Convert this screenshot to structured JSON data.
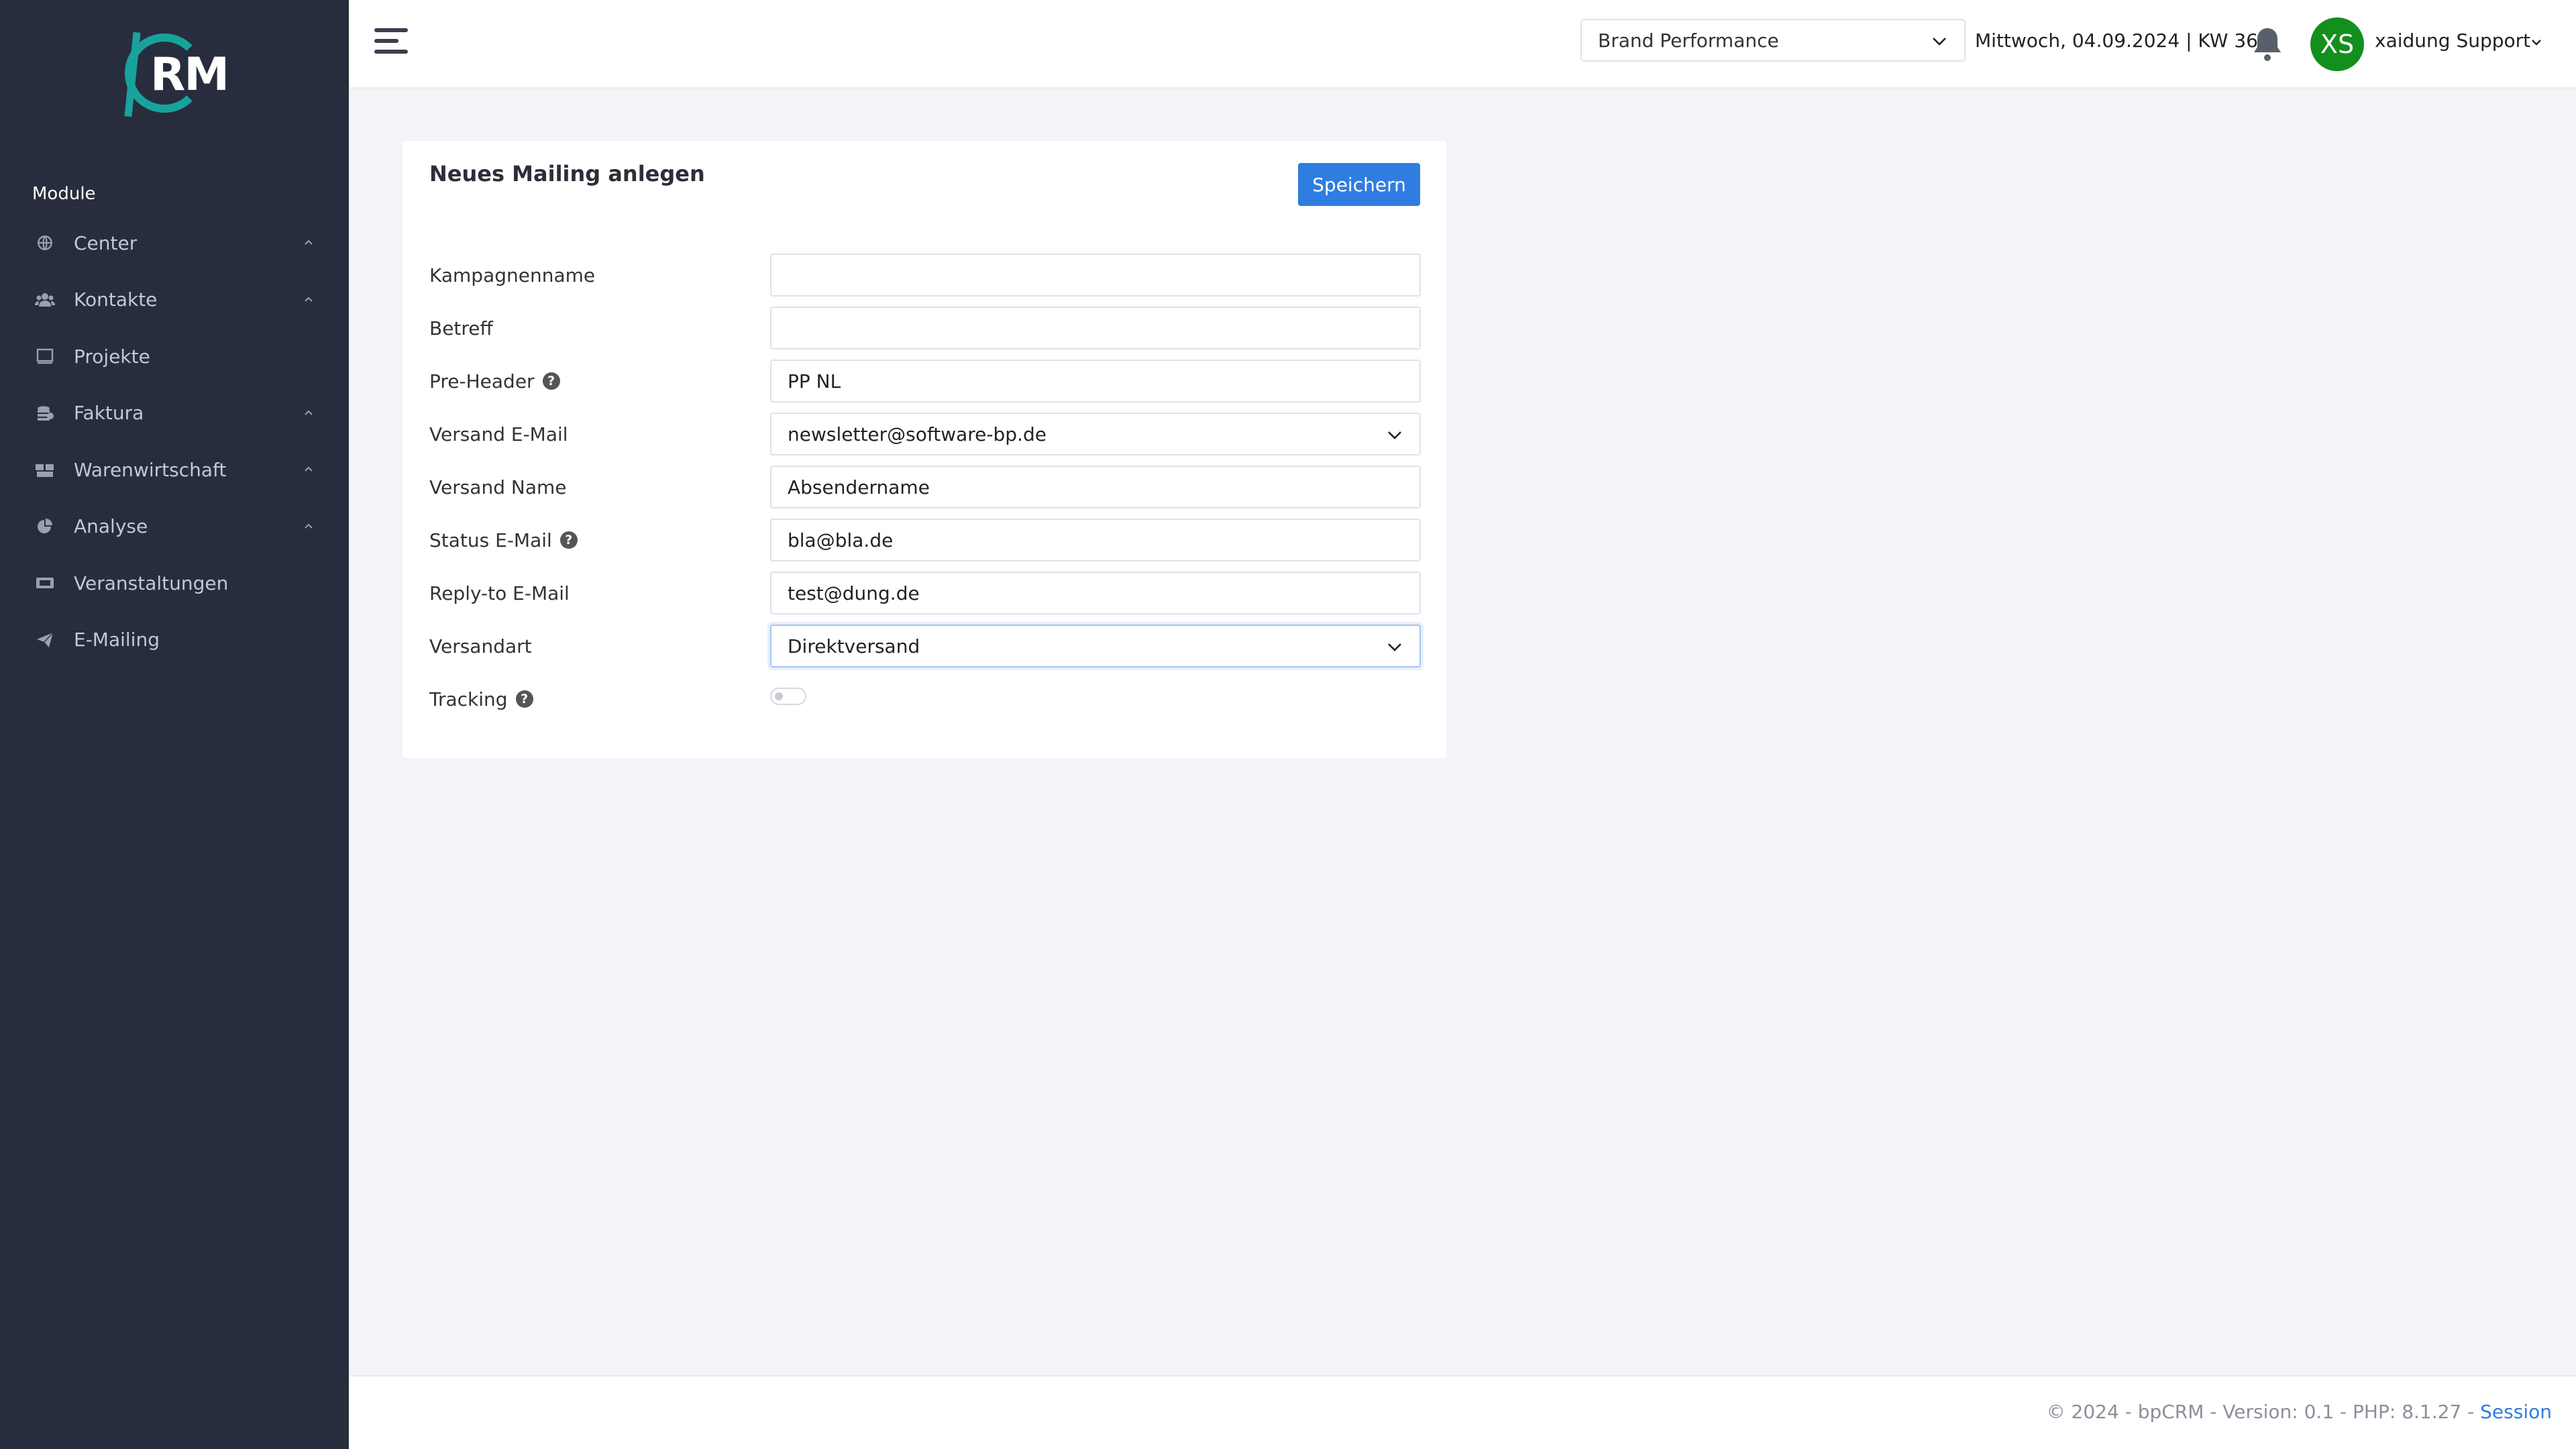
{
  "app": {
    "logo_text": "RM",
    "brand_color": "#17a39b"
  },
  "sidebar": {
    "section_label": "Module",
    "items": [
      {
        "label": "Center",
        "icon": "globe-icon",
        "has_chevron": true
      },
      {
        "label": "Kontakte",
        "icon": "users-icon",
        "has_chevron": true
      },
      {
        "label": "Projekte",
        "icon": "book-icon",
        "has_chevron": false
      },
      {
        "label": "Faktura",
        "icon": "coins-icon",
        "has_chevron": true
      },
      {
        "label": "Warenwirtschaft",
        "icon": "boxes-icon",
        "has_chevron": true
      },
      {
        "label": "Analyse",
        "icon": "chart-pie-icon",
        "has_chevron": true
      },
      {
        "label": "Veranstaltungen",
        "icon": "ticket-icon",
        "has_chevron": false
      },
      {
        "label": "E-Mailing",
        "icon": "paper-plane-icon",
        "has_chevron": false
      }
    ]
  },
  "header": {
    "brand_select_value": "Brand Performance",
    "date_text": "Mittwoch, 04.09.2024 | KW 36",
    "avatar_initials": "XS",
    "avatar_color": "#138f1e",
    "user_name": "xaidung Support"
  },
  "form": {
    "title": "Neues Mailing anlegen",
    "save_label": "Speichern",
    "fields": {
      "kampagnenname": {
        "label": "Kampagnenname",
        "value": ""
      },
      "betreff": {
        "label": "Betreff",
        "value": ""
      },
      "pre_header": {
        "label": "Pre-Header",
        "value": "PP NL"
      },
      "versand_email": {
        "label": "Versand E-Mail",
        "value": "newsletter@software-bp.de"
      },
      "versand_name": {
        "label": "Versand Name",
        "value": "Absendername"
      },
      "status_email": {
        "label": "Status E-Mail",
        "value": "bla@bla.de"
      },
      "reply_to": {
        "label": "Reply-to E-Mail",
        "value": "test@dung.de"
      },
      "versandart": {
        "label": "Versandart",
        "value": "Direktversand"
      },
      "tracking": {
        "label": "Tracking",
        "enabled": false
      }
    },
    "help_glyph": "?"
  },
  "footer": {
    "text": "© 2024 - bpCRM - Version: 0.1 - PHP: 8.1.27 - ",
    "link_label": "Session"
  }
}
